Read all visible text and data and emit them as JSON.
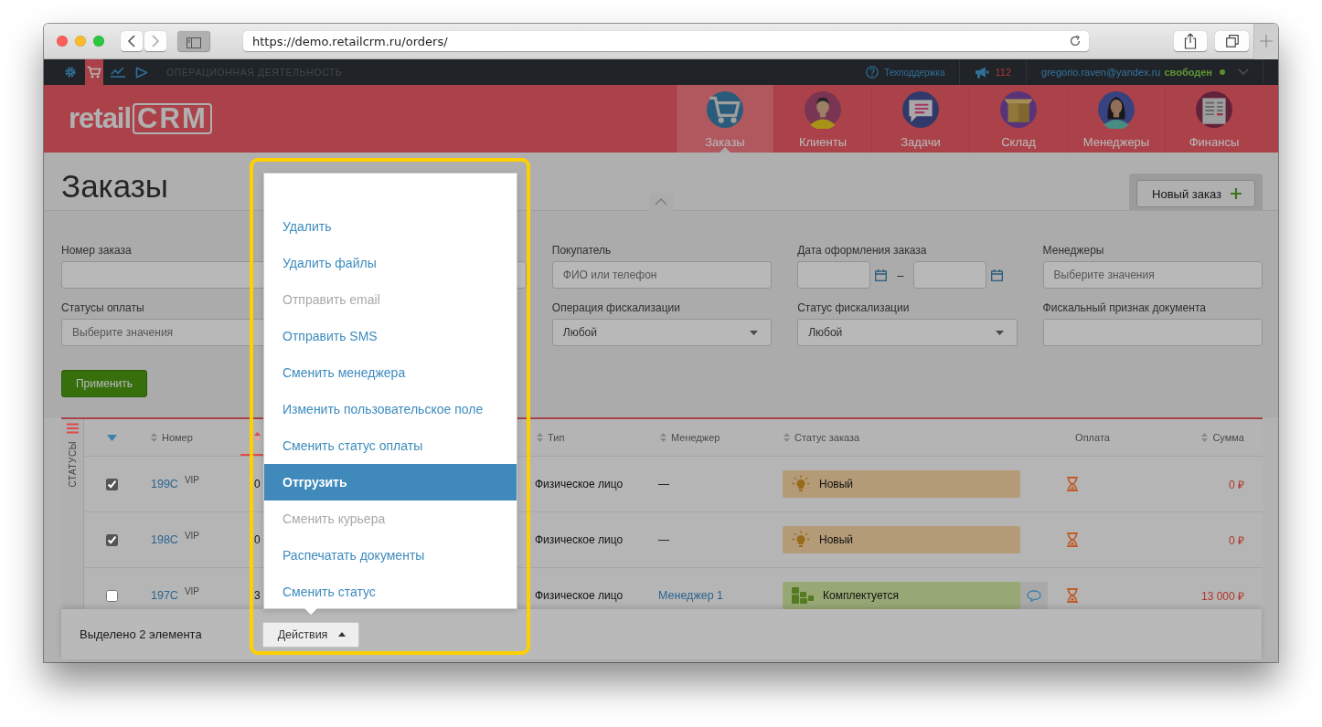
{
  "browser": {
    "url": "https://demo.retailcrm.ru/orders/"
  },
  "topbar": {
    "apps": [
      {
        "kind": "settings",
        "selected": false
      },
      {
        "kind": "cart",
        "selected": true
      },
      {
        "kind": "chart",
        "selected": false
      },
      {
        "kind": "play",
        "selected": false
      }
    ],
    "section": "ОПЕРАЦИОННАЯ ДЕЯТЕЛЬНОСТЬ",
    "support": "Техподдержка",
    "notifications": "112",
    "user": "gregorio.raven@yandex.ru",
    "status": "свободен"
  },
  "header": {
    "logo_word": "retail",
    "logo_mark": "CRM",
    "nav": [
      {
        "label": "Заказы",
        "kind": "cart",
        "selected": true
      },
      {
        "label": "Клиенты",
        "kind": "client",
        "selected": false
      },
      {
        "label": "Задачи",
        "kind": "tasks",
        "selected": false
      },
      {
        "label": "Склад",
        "kind": "box",
        "selected": false
      },
      {
        "label": "Менеджеры",
        "kind": "manager",
        "selected": false
      },
      {
        "label": "Финансы",
        "kind": "finance",
        "selected": false
      }
    ]
  },
  "page": {
    "title": "Заказы",
    "new_order": "Новый заказ"
  },
  "filters": {
    "row_1": [
      {
        "label": "Номер заказа",
        "kind": "text"
      },
      {
        "kind": "text"
      },
      {
        "label": "Покупатель",
        "kind": "text",
        "placeholder": "ФИО или телефон"
      },
      {
        "label": "Дата оформления заказа",
        "kind": "date_range",
        "separator": "–"
      },
      {
        "label": "Менеджеры",
        "kind": "text",
        "placeholder": "Выберите значения"
      }
    ],
    "row_2": [
      {
        "label": "Статусы оплаты",
        "kind": "text",
        "placeholder": "Выберите значения"
      },
      {
        "label": "Операция фискализации",
        "kind": "select",
        "value": "Любой"
      },
      {
        "label": "Статус фискализации",
        "kind": "select",
        "value": "Любой"
      },
      {
        "label": "Фискальный признак документа",
        "kind": "text"
      }
    ],
    "apply": "Применить"
  },
  "table": {
    "side_label": "СТАТУСЫ",
    "columns": [
      {
        "label": "Номер",
        "sortable": true,
        "sorted": false
      },
      {
        "sortable": true,
        "sorted": true
      },
      {
        "label": "Тип",
        "sortable": true,
        "sorted": false
      },
      {
        "label": "Менеджер",
        "sortable": true,
        "sorted": false
      },
      {
        "label": "Статус заказа",
        "sortable": true,
        "sorted": false
      },
      {
        "label": "Оплата",
        "sortable": false
      },
      {
        "label": "Сумма",
        "sortable": true,
        "sorted": false
      }
    ],
    "rows": [
      {
        "checked": true,
        "number": "199C",
        "tag": "VIP",
        "date": "0",
        "type": "Физическое лицо",
        "manager": "—",
        "manager_link": false,
        "status": "Новый",
        "kind": "new",
        "color": "#b49b77",
        "comment": false,
        "amount": "0 ₽"
      },
      {
        "checked": true,
        "number": "198C",
        "tag": "VIP",
        "date": "0",
        "type": "Физическое лицо",
        "manager": "—",
        "manager_link": false,
        "status": "Новый",
        "kind": "new",
        "color": "#b49b77",
        "comment": false,
        "amount": "0 ₽"
      },
      {
        "checked": false,
        "number": "197C",
        "tag": "VIP",
        "date": "3",
        "type": "Физическое лицо",
        "manager": "Менеджер 1",
        "manager_link": true,
        "status": "Комплектуется",
        "kind": "assembling",
        "color": "#98a875",
        "comment": true,
        "amount": "13 000 ₽"
      }
    ]
  },
  "selection_bar": {
    "count_text": "Выделено 2 элемента",
    "actions": "Действия"
  },
  "actions_menu": [
    {
      "label": "Удалить",
      "disabled": false,
      "selected": false
    },
    {
      "label": "Удалить файлы",
      "disabled": false,
      "selected": false
    },
    {
      "label": "Отправить email",
      "disabled": true,
      "selected": false
    },
    {
      "label": "Отправить SMS",
      "disabled": false,
      "selected": false
    },
    {
      "label": "Сменить менеджера",
      "disabled": false,
      "selected": false
    },
    {
      "label": "Изменить пользовательское поле",
      "disabled": false,
      "selected": false
    },
    {
      "label": "Сменить статус оплаты",
      "disabled": false,
      "selected": false
    },
    {
      "label": "Отгрузить",
      "disabled": false,
      "selected": true
    },
    {
      "label": "Сменить курьера",
      "disabled": true,
      "selected": false
    },
    {
      "label": "Распечатать документы",
      "disabled": false,
      "selected": false
    },
    {
      "label": "Сменить статус",
      "disabled": false,
      "selected": false
    }
  ]
}
